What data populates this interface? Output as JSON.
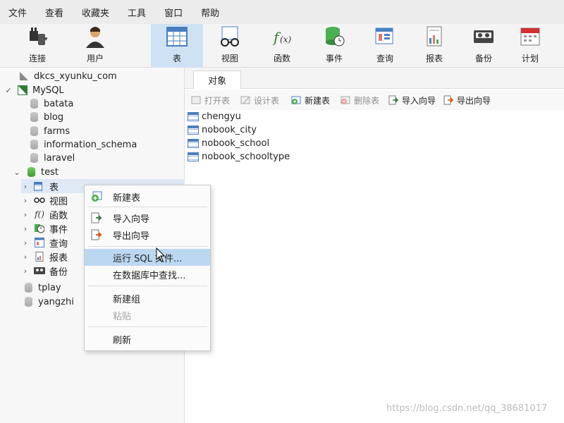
{
  "menu": [
    "文件",
    "查看",
    "收藏夹",
    "工具",
    "窗口",
    "帮助"
  ],
  "toolbar": {
    "connect": "连接",
    "user": "用户",
    "table": "表",
    "view": "视图",
    "function": "函数",
    "event": "事件",
    "query": "查询",
    "report": "报表",
    "backup": "备份",
    "schedule": "计划"
  },
  "tree": {
    "dkcs": "dkcs_xyunku_com",
    "mysql": "MySQL",
    "dbs": [
      "batata",
      "blog",
      "farms",
      "information_schema",
      "laravel"
    ],
    "test": "test",
    "test_children": [
      "表",
      "视图",
      "函数",
      "事件",
      "查询",
      "报表",
      "备份"
    ],
    "after": [
      "tplay",
      "yangzhi"
    ]
  },
  "object_tab": "对象",
  "object_toolbar": {
    "open": "打开表",
    "design": "设计表",
    "new": "新建表",
    "delete": "删除表",
    "import": "导入向导",
    "export": "导出向导"
  },
  "tables": [
    "chengyu",
    "nobook_city",
    "nobook_school",
    "nobook_schooltype"
  ],
  "context_menu": {
    "new_table": "新建表",
    "import": "导入向导",
    "export": "导出向导",
    "run_sql": "运行 SQL 文件...",
    "find": "在数据库中查找...",
    "new_group": "新建组",
    "paste": "粘贴",
    "refresh": "刷新"
  },
  "watermark": "https://blog.csdn.net/qq_38681017",
  "colors": {
    "accent": "#cfe2f3",
    "menu_highlight": "#bcd8f1",
    "db_green": "#3f9a2b"
  }
}
